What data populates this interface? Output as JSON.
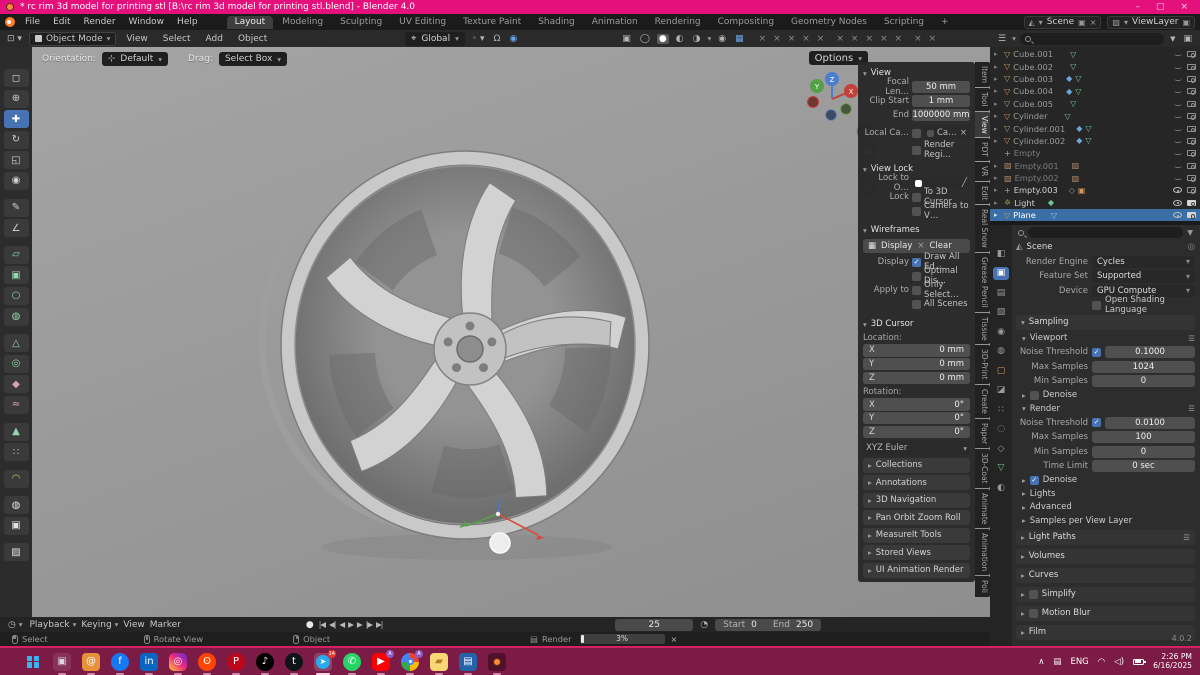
{
  "icons": {
    "chevron": "▾",
    "chevron_right": "▸",
    "chevron_up": "∧",
    "close": "×",
    "check": "✓",
    "minimize": "–",
    "maximize": "▢",
    "mesh": "▽",
    "empty_axes": "+",
    "image_empty": "▨",
    "light": "☼",
    "wrench": "◆",
    "data": "▽",
    "constraint": "◇",
    "camera_badge": "▣",
    "driver": "◆",
    "magnet": "Ω",
    "prop_edit": "◉",
    "wire": "◯",
    "solid": "●",
    "material": "◐",
    "rendered": "◑",
    "overlays": "◉",
    "xray": "▦",
    "gizmos": "▣",
    "x_mark": "×",
    "eyedropper": "╱",
    "pin": "◎",
    "copy": "▣",
    "list": "☰",
    "funnel": "▼",
    "record": "●",
    "t_start": "|◀",
    "t_prevkey": "◀|",
    "t_prev": "◀",
    "t_play": "▶",
    "t_next": "▶",
    "t_nextkey": "|▶",
    "t_end": "▶|",
    "stopwatch": "◔",
    "grid": "⊞",
    "tool_select": "◻",
    "tool_cursor": "⊕",
    "tool_move": "✚",
    "tool_rotate": "↻",
    "tool_scale": "◱",
    "tool_transform": "◉",
    "tool_annotate": "✎",
    "tool_measure": "∠",
    "add1": "▱",
    "add2": "▣",
    "add3": "○",
    "add4": "◍",
    "add5": "△",
    "add6": "◎",
    "add7": "◆",
    "add8": "≈",
    "add9": "▲",
    "add10": "∷",
    "add11": "◠",
    "add12": "◍",
    "add13": "▣",
    "add14": "▨",
    "prop_tabs": [
      "◧",
      "▣",
      "▤",
      "▧",
      "◉",
      "◍",
      "▢",
      "◪",
      "∷",
      "◌",
      "◇",
      "▽",
      "◐"
    ],
    "axis_x": "X",
    "axis_y": "Y",
    "axis_z": "Z"
  },
  "titlebar": {
    "title": "* rc rim 3d model for printing stl [B:\\rc rim 3d model for printing stl.blend] - Blender 4.0"
  },
  "menubar": {
    "menus": [
      "File",
      "Edit",
      "Render",
      "Window",
      "Help"
    ],
    "tabs": [
      "Layout",
      "Modeling",
      "Sculpting",
      "UV Editing",
      "Texture Paint",
      "Shading",
      "Animation",
      "Rendering",
      "Compositing",
      "Geometry Nodes",
      "Scripting"
    ],
    "add_tab": "+",
    "scene": "Scene",
    "viewlayer": "ViewLayer"
  },
  "toolheader": {
    "mode": "Object Mode",
    "menus": [
      "View",
      "Select",
      "Add",
      "Object"
    ],
    "orientation": "Global"
  },
  "viewport": {
    "orientation_label": "Orientation:",
    "orientation_value": "Default",
    "drag_label": "Drag:",
    "drag_value": "Select Box",
    "options": "Options"
  },
  "npanel": {
    "tabs": [
      "Item",
      "Tool",
      "View",
      "PDT",
      "VR",
      "Edit",
      "Real Snow",
      "Grease Pencil",
      "Tissue",
      "3D-Print",
      "Create",
      "Paper",
      "3D-Coat",
      "Animate",
      "Animation",
      "Poli"
    ],
    "view": {
      "title": "View",
      "focal_label": "Focal Len…",
      "focal": "50 mm",
      "clip_label": "Clip Start",
      "clip": "1 mm",
      "end_label": "End",
      "end": "1000000 mm",
      "local_label": "Local Ca…",
      "local_value": "Ca…",
      "render_region": "Render Regi…"
    },
    "view_lock": {
      "title": "View Lock",
      "lock_to": "Lock to O…",
      "lock": "Lock",
      "to_cursor": "To 3D Cursor",
      "camera_to": "Camera to V…"
    },
    "wireframes": {
      "title": "Wireframes",
      "display_btn": "Display",
      "clear_btn": "Clear",
      "display": "Display",
      "draw_all": "Draw All Ed…",
      "optimal": "Optimal Dis…",
      "apply_to": "Apply to",
      "only_sel": "Only Select…",
      "all_scenes": "All Scenes"
    },
    "cursor": {
      "title": "3D Cursor",
      "location": "Location:",
      "x": "X",
      "y": "Y",
      "z": "Z",
      "xv": "0 mm",
      "yv": "0 mm",
      "zv": "0 mm",
      "rotation": "Rotation:",
      "rxv": "0°",
      "ryv": "0°",
      "rzv": "0°",
      "euler": "XYZ Euler"
    },
    "collapsed": [
      "Collections",
      "Annotations",
      "3D Navigation",
      "Pan Orbit Zoom Roll",
      "MeasureIt Tools",
      "Stored Views",
      "UI Animation Render"
    ]
  },
  "outliner": {
    "items": [
      {
        "name": "Cube.001"
      },
      {
        "name": "Cube.002"
      },
      {
        "name": "Cube.003"
      },
      {
        "name": "Cube.004"
      },
      {
        "name": "Cube.005"
      },
      {
        "name": "Cylinder"
      },
      {
        "name": "Cylinder.001"
      },
      {
        "name": "Cylinder.002"
      },
      {
        "name": "Empty"
      },
      {
        "name": "Empty.001"
      },
      {
        "name": "Empty.002"
      },
      {
        "name": "Empty.003"
      },
      {
        "name": "Light"
      },
      {
        "name": "Plane"
      }
    ]
  },
  "properties": {
    "breadcrumb": "Scene",
    "render_engine_label": "Render Engine",
    "render_engine": "Cycles",
    "feature_set_label": "Feature Set",
    "feature_set": "Supported",
    "device_label": "Device",
    "device": "GPU Compute",
    "osl": "Open Shading Language",
    "sampling": "Sampling",
    "viewport": "Viewport",
    "noise_label": "Noise Threshold",
    "vp_noise": "0.1000",
    "max_label": "Max Samples",
    "vp_max": "1024",
    "min_label": "Min Samples",
    "vp_min": "0",
    "denoise": "Denoise",
    "render": "Render",
    "r_noise": "0.0100",
    "r_max": "100",
    "r_min": "0",
    "time_label": "Time Limit",
    "time": "0 sec",
    "sub_sections": [
      "Lights",
      "Advanced",
      "Samples per View Layer"
    ],
    "sections": [
      "Light Paths",
      "Volumes",
      "Curves",
      "Simplify",
      "Motion Blur",
      "Film"
    ],
    "version": "4.0.2"
  },
  "timeline": {
    "menus": [
      "Playback",
      "Keying",
      "View",
      "Marker"
    ],
    "frame": "25",
    "start_label": "Start",
    "start": "0",
    "end_label": "End",
    "end": "250"
  },
  "statusbar": {
    "select": "Select",
    "rotate": "Rotate View",
    "object": "Object",
    "render_label": "Render",
    "progress": "3%"
  },
  "taskbar": {
    "lang": "ENG",
    "time": "2:26 PM",
    "date": "6/16/2025"
  }
}
